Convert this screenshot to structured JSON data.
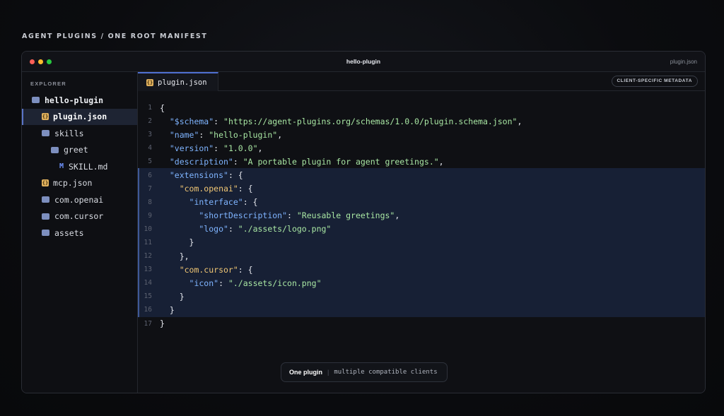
{
  "page_label": "AGENT PLUGINS / ONE ROOT MANIFEST",
  "window": {
    "title": "hello-plugin",
    "file": "plugin.json"
  },
  "sidebar": {
    "header": "EXPLORER",
    "items": [
      {
        "label": "hello-plugin",
        "icon": "folder-icon"
      },
      {
        "label": "plugin.json",
        "icon": "json-file-icon",
        "glyph": "{}"
      },
      {
        "label": "skills",
        "icon": "folder-icon"
      },
      {
        "label": "greet",
        "icon": "folder-icon"
      },
      {
        "label": "SKILL.md",
        "icon": "markdown-icon",
        "glyph": "M"
      },
      {
        "label": "mcp.json",
        "icon": "json-file-icon",
        "glyph": "{}"
      },
      {
        "label": "com.openai",
        "icon": "folder-icon"
      },
      {
        "label": "com.cursor",
        "icon": "folder-icon"
      },
      {
        "label": "assets",
        "icon": "folder-icon"
      }
    ]
  },
  "editor": {
    "tab": {
      "label": "plugin.json",
      "glyph": "{}"
    },
    "badge": "CLIENT-SPECIFIC METADATA",
    "lines": [
      {
        "n": "1",
        "parts": [
          {
            "t": "{",
            "c": "p"
          }
        ]
      },
      {
        "n": "2",
        "parts": [
          {
            "t": "  \"$schema\"",
            "c": "k"
          },
          {
            "t": ": ",
            "c": "p"
          },
          {
            "t": "\"https://agent-plugins.org/schemas/1.0.0/plugin.schema.json\"",
            "c": "s"
          },
          {
            "t": ",",
            "c": "p"
          }
        ]
      },
      {
        "n": "3",
        "parts": [
          {
            "t": "  \"name\"",
            "c": "k"
          },
          {
            "t": ": ",
            "c": "p"
          },
          {
            "t": "\"hello-plugin\"",
            "c": "s"
          },
          {
            "t": ",",
            "c": "p"
          }
        ]
      },
      {
        "n": "4",
        "parts": [
          {
            "t": "  \"version\"",
            "c": "k"
          },
          {
            "t": ": ",
            "c": "p"
          },
          {
            "t": "\"1.0.0\"",
            "c": "s"
          },
          {
            "t": ",",
            "c": "p"
          }
        ]
      },
      {
        "n": "5",
        "parts": [
          {
            "t": "  \"description\"",
            "c": "k"
          },
          {
            "t": ": ",
            "c": "p"
          },
          {
            "t": "\"A portable plugin for agent greetings.\"",
            "c": "s"
          },
          {
            "t": ",",
            "c": "p"
          }
        ]
      },
      {
        "n": "6",
        "parts": [
          {
            "t": "  \"extensions\"",
            "c": "k"
          },
          {
            "t": ": {",
            "c": "p"
          }
        ]
      },
      {
        "n": "7",
        "parts": [
          {
            "t": "    \"com.openai\"",
            "c": "k2"
          },
          {
            "t": ": {",
            "c": "p"
          }
        ]
      },
      {
        "n": "8",
        "parts": [
          {
            "t": "      \"interface\"",
            "c": "k"
          },
          {
            "t": ": {",
            "c": "p"
          }
        ]
      },
      {
        "n": "9",
        "parts": [
          {
            "t": "        \"shortDescription\"",
            "c": "k"
          },
          {
            "t": ": ",
            "c": "p"
          },
          {
            "t": "\"Reusable greetings\"",
            "c": "s"
          },
          {
            "t": ",",
            "c": "p"
          }
        ]
      },
      {
        "n": "10",
        "parts": [
          {
            "t": "        \"logo\"",
            "c": "k"
          },
          {
            "t": ": ",
            "c": "p"
          },
          {
            "t": "\"./assets/logo.png\"",
            "c": "s"
          }
        ]
      },
      {
        "n": "11",
        "parts": [
          {
            "t": "      }",
            "c": "p"
          }
        ]
      },
      {
        "n": "12",
        "parts": [
          {
            "t": "    },",
            "c": "p"
          }
        ]
      },
      {
        "n": "13",
        "parts": [
          {
            "t": "    \"com.cursor\"",
            "c": "k2"
          },
          {
            "t": ": {",
            "c": "p"
          }
        ]
      },
      {
        "n": "14",
        "parts": [
          {
            "t": "      \"icon\"",
            "c": "k"
          },
          {
            "t": ": ",
            "c": "p"
          },
          {
            "t": "\"./assets/icon.png\"",
            "c": "s"
          }
        ]
      },
      {
        "n": "15",
        "parts": [
          {
            "t": "    }",
            "c": "p"
          }
        ]
      },
      {
        "n": "16",
        "parts": [
          {
            "t": "  }",
            "c": "p"
          }
        ]
      },
      {
        "n": "17",
        "parts": [
          {
            "t": "}",
            "c": "p"
          }
        ]
      }
    ],
    "highlighted_lines": [
      "6",
      "7",
      "8",
      "9",
      "10",
      "11",
      "12",
      "13",
      "14",
      "15",
      "16"
    ]
  },
  "footer": {
    "strong": "One plugin",
    "separator": "|",
    "rest": "multiple compatible clients"
  }
}
